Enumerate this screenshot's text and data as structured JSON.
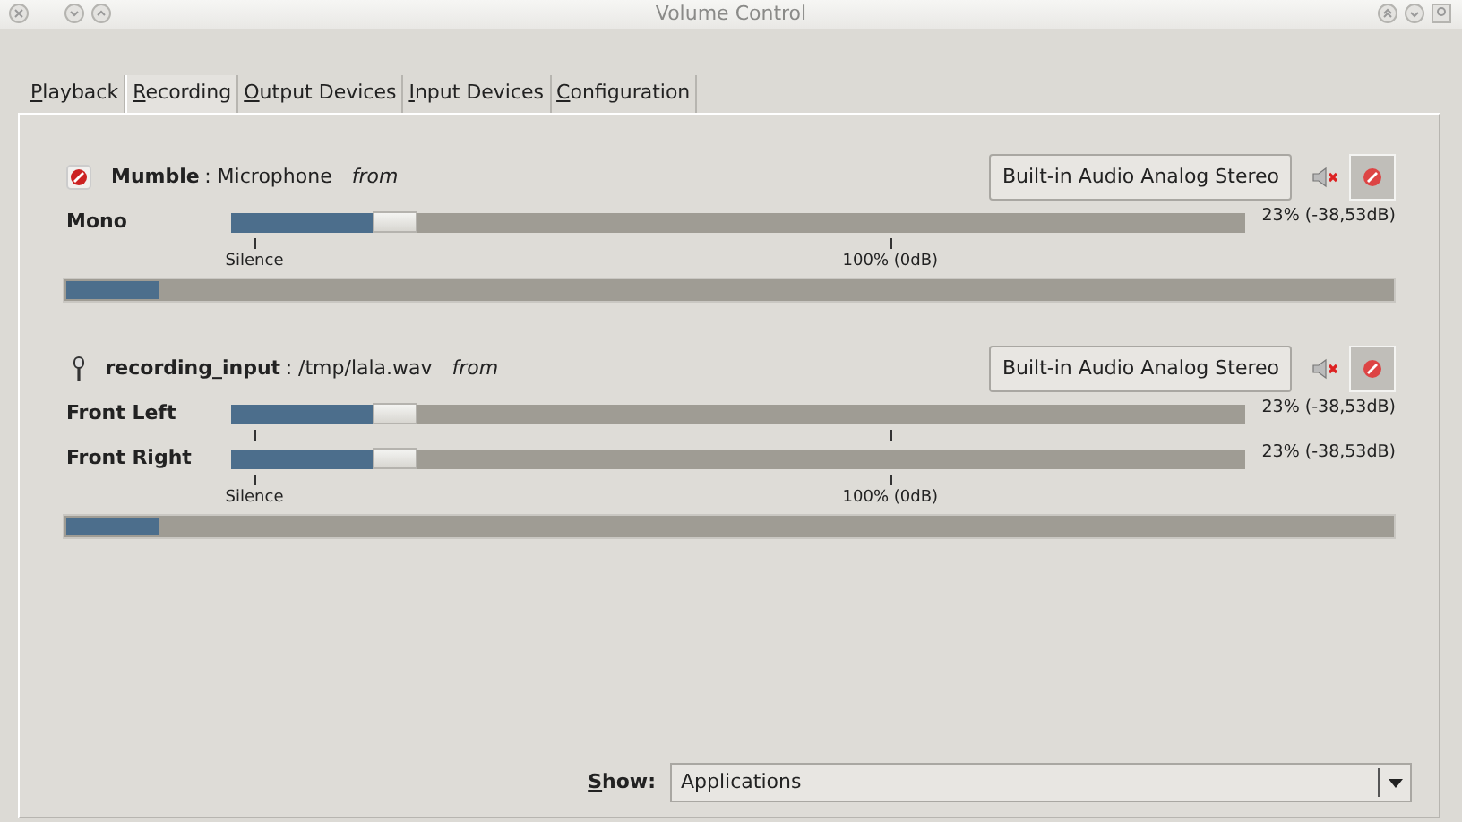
{
  "window": {
    "title": "Volume Control"
  },
  "tabs": [
    {
      "label": "Playback",
      "selected": false
    },
    {
      "label": "Recording",
      "selected": true
    },
    {
      "label": "Output Devices",
      "selected": false
    },
    {
      "label": "Input Devices",
      "selected": false
    },
    {
      "label": "Configuration",
      "selected": false
    }
  ],
  "streams": [
    {
      "kind": "app",
      "name": "Mumble",
      "description": ": Microphone",
      "direction": "from",
      "device": "Built-in Audio Analog Stereo",
      "lock_pressed": true,
      "channels": [
        {
          "name": "Mono",
          "level": 0.16,
          "reading": "23% (-38,53dB)"
        }
      ],
      "scale": [
        "Silence",
        "100% (0dB)"
      ],
      "peak": {
        "level": 0.07
      }
    },
    {
      "kind": "mic",
      "name": "recording_input",
      "description": ": /tmp/lala.wav",
      "direction": "from",
      "device": "Built-in Audio Analog Stereo",
      "lock_pressed": true,
      "channels": [
        {
          "name": "Front Left",
          "level": 0.16,
          "reading": "23% (-38,53dB)"
        },
        {
          "name": "Front Right",
          "level": 0.16,
          "reading": "23% (-38,53dB)"
        }
      ],
      "scale": [
        "Silence",
        "100% (0dB)"
      ],
      "peak": {
        "level": 0.07
      }
    }
  ],
  "show": {
    "label": "Show:",
    "value": "Applications"
  }
}
